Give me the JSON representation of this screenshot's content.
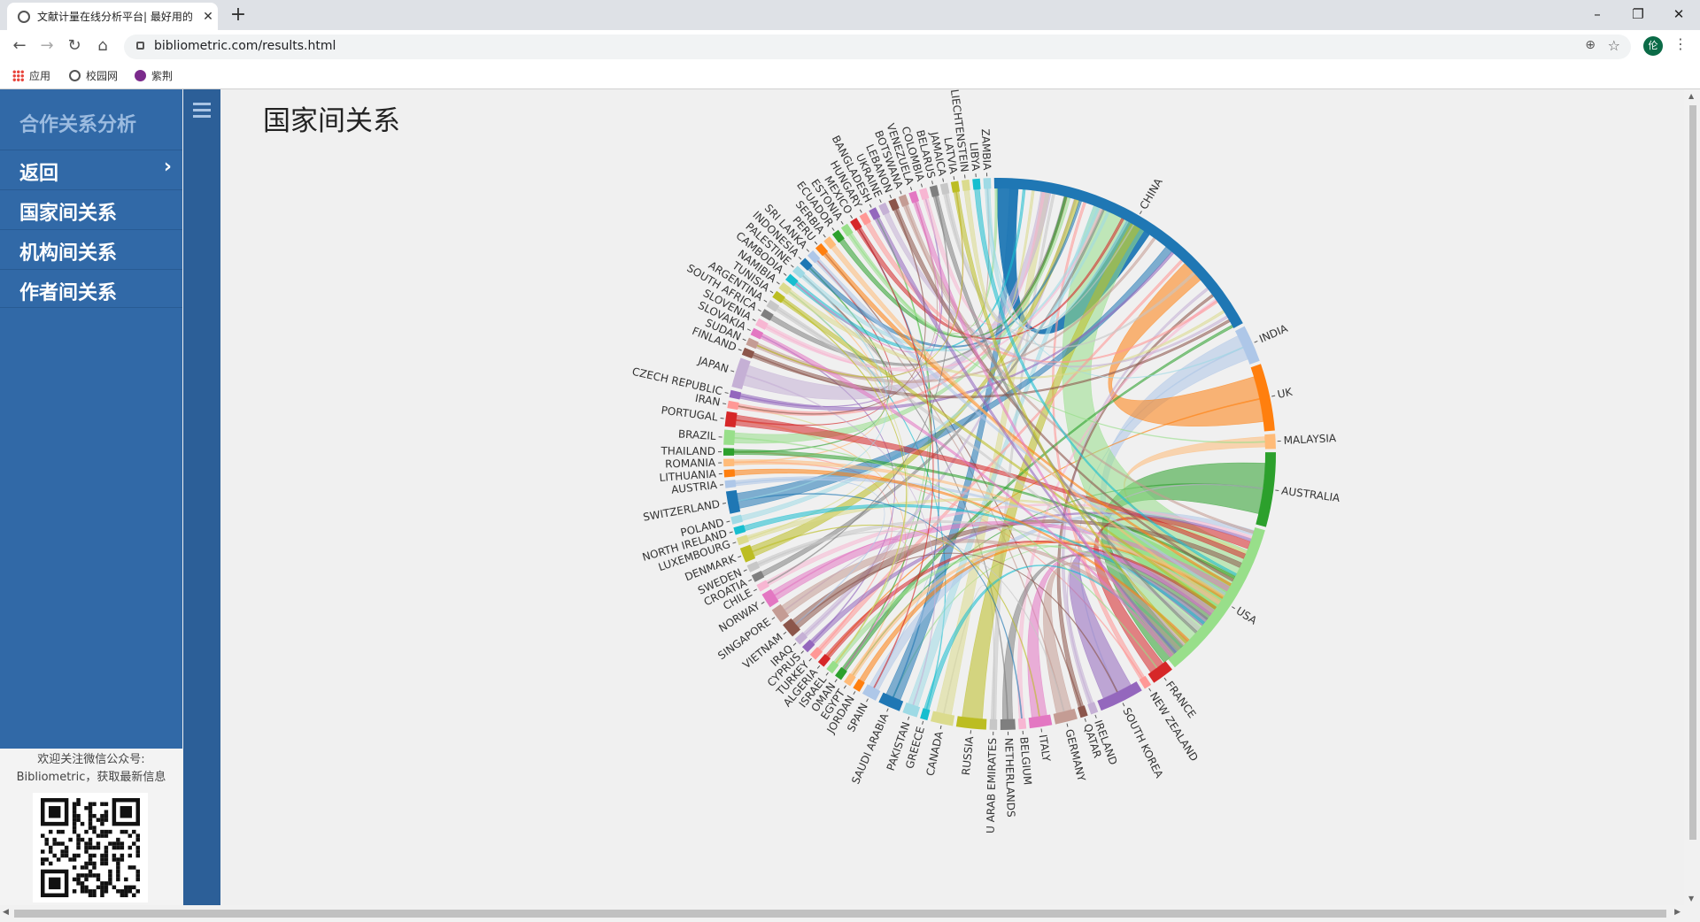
{
  "browser": {
    "tab_title": "文献计量在线分析平台| 最好用的",
    "url": "bibliometric.com/results.html",
    "avatar": "伦",
    "bookmarks": [
      "应用",
      "校园网",
      "紫荆"
    ]
  },
  "sidebar": {
    "title": "合作关系分析",
    "items": [
      {
        "label": "返回"
      },
      {
        "label": "国家间关系"
      },
      {
        "label": "机构间关系"
      },
      {
        "label": "作者间关系"
      }
    ],
    "footer_line1": "欢迎关注微信公众号:",
    "footer_line2": "Bibliometric，获取最新信息"
  },
  "main": {
    "title": "国家间关系"
  },
  "chart_data": {
    "type": "chord",
    "countries": [
      {
        "name": "CHINA",
        "color": "#1f77b4",
        "weight": 40
      },
      {
        "name": "INDIA",
        "color": "#aec7e8",
        "weight": 5
      },
      {
        "name": "UK",
        "color": "#ff7f0e",
        "weight": 9
      },
      {
        "name": "MALAYSIA",
        "color": "#ffbb78",
        "weight": 2
      },
      {
        "name": "AUSTRALIA",
        "color": "#2ca02c",
        "weight": 10
      },
      {
        "name": "USA",
        "color": "#98df8a",
        "weight": 22
      },
      {
        "name": "FRANCE",
        "color": "#d62728",
        "weight": 3
      },
      {
        "name": "NEW ZEALAND",
        "color": "#ff9896",
        "weight": 1
      },
      {
        "name": "SOUTH KOREA",
        "color": "#9467bd",
        "weight": 6
      },
      {
        "name": "IRELAND",
        "color": "#c5b0d5",
        "weight": 1
      },
      {
        "name": "QATAR",
        "color": "#8c564b",
        "weight": 1
      },
      {
        "name": "GERMANY",
        "color": "#c49c94",
        "weight": 3
      },
      {
        "name": "ITALY",
        "color": "#e377c2",
        "weight": 3
      },
      {
        "name": "BELGIUM",
        "color": "#f7b6d2",
        "weight": 1
      },
      {
        "name": "NETHERLANDS",
        "color": "#7f7f7f",
        "weight": 2
      },
      {
        "name": "U ARAB EMIRATES",
        "color": "#c7c7c7",
        "weight": 1
      },
      {
        "name": "RUSSIA",
        "color": "#bcbd22",
        "weight": 4
      },
      {
        "name": "CANADA",
        "color": "#dbdb8d",
        "weight": 3
      },
      {
        "name": "GREECE",
        "color": "#17becf",
        "weight": 1
      },
      {
        "name": "PAKISTAN",
        "color": "#9edae5",
        "weight": 2
      },
      {
        "name": "SAUDI ARABIA",
        "color": "#1f77b4",
        "weight": 3
      },
      {
        "name": "SPAIN",
        "color": "#aec7e8",
        "weight": 2
      },
      {
        "name": "JORDAN",
        "color": "#ff7f0e",
        "weight": 1
      },
      {
        "name": "EGYPT",
        "color": "#ffbb78",
        "weight": 1
      },
      {
        "name": "OMAN",
        "color": "#2ca02c",
        "weight": 1
      },
      {
        "name": "ISRAEL",
        "color": "#98df8a",
        "weight": 1
      },
      {
        "name": "ALGERIA",
        "color": "#d62728",
        "weight": 1
      },
      {
        "name": "TURKEY",
        "color": "#ff9896",
        "weight": 1
      },
      {
        "name": "CYPRUS",
        "color": "#9467bd",
        "weight": 1
      },
      {
        "name": "IRAQ",
        "color": "#c5b0d5",
        "weight": 1
      },
      {
        "name": "VIETNAM",
        "color": "#8c564b",
        "weight": 2
      },
      {
        "name": "SINGAPORE",
        "color": "#c49c94",
        "weight": 2
      },
      {
        "name": "NORWAY",
        "color": "#e377c2",
        "weight": 2
      },
      {
        "name": "CHILE",
        "color": "#f7b6d2",
        "weight": 1
      },
      {
        "name": "CROATIA",
        "color": "#7f7f7f",
        "weight": 1
      },
      {
        "name": "SWEDEN",
        "color": "#c7c7c7",
        "weight": 1
      },
      {
        "name": "DENMARK",
        "color": "#bcbd22",
        "weight": 2
      },
      {
        "name": "LUXEMBOURG",
        "color": "#dbdb8d",
        "weight": 1
      },
      {
        "name": "NORTH IRELAND",
        "color": "#17becf",
        "weight": 1
      },
      {
        "name": "POLAND",
        "color": "#9edae5",
        "weight": 1
      },
      {
        "name": "SWITZERLAND",
        "color": "#1f77b4",
        "weight": 3
      },
      {
        "name": "AUSTRIA",
        "color": "#aec7e8",
        "weight": 1
      },
      {
        "name": "LITHUANIA",
        "color": "#ff7f0e",
        "weight": 1
      },
      {
        "name": "ROMANIA",
        "color": "#ffbb78",
        "weight": 1
      },
      {
        "name": "THAILAND",
        "color": "#2ca02c",
        "weight": 1
      },
      {
        "name": "BRAZIL",
        "color": "#98df8a",
        "weight": 2
      },
      {
        "name": "PORTUGAL",
        "color": "#d62728",
        "weight": 2
      },
      {
        "name": "IRAN",
        "color": "#ff9896",
        "weight": 1
      },
      {
        "name": "CZECH REPUBLIC",
        "color": "#9467bd",
        "weight": 1
      },
      {
        "name": "JAPAN",
        "color": "#c5b0d5",
        "weight": 4
      },
      {
        "name": "FINLAND",
        "color": "#8c564b",
        "weight": 1
      },
      {
        "name": "SUDAN",
        "color": "#c49c94",
        "weight": 1
      },
      {
        "name": "SLOVAKIA",
        "color": "#e377c2",
        "weight": 1
      },
      {
        "name": "SLOVENIA",
        "color": "#f7b6d2",
        "weight": 1
      },
      {
        "name": "SOUTH AFRICA",
        "color": "#7f7f7f",
        "weight": 1
      },
      {
        "name": "ARGENTINA",
        "color": "#c7c7c7",
        "weight": 1
      },
      {
        "name": "TUNISIA",
        "color": "#bcbd22",
        "weight": 1
      },
      {
        "name": "NAMIBIA",
        "color": "#dbdb8d",
        "weight": 1
      },
      {
        "name": "CAMBODIA",
        "color": "#17becf",
        "weight": 1
      },
      {
        "name": "PALESTINE",
        "color": "#9edae5",
        "weight": 1
      },
      {
        "name": "INDONESIA",
        "color": "#1f77b4",
        "weight": 1
      },
      {
        "name": "SRI LANKA",
        "color": "#aec7e8",
        "weight": 1
      },
      {
        "name": "PERU",
        "color": "#ff7f0e",
        "weight": 1
      },
      {
        "name": "SERBIA",
        "color": "#ffbb78",
        "weight": 1
      },
      {
        "name": "ECUADOR",
        "color": "#2ca02c",
        "weight": 1
      },
      {
        "name": "ESTONIA",
        "color": "#98df8a",
        "weight": 1
      },
      {
        "name": "MEXICO",
        "color": "#d62728",
        "weight": 1
      },
      {
        "name": "HUNGARY",
        "color": "#ff9896",
        "weight": 1
      },
      {
        "name": "BANGLADESH",
        "color": "#9467bd",
        "weight": 1
      },
      {
        "name": "UKRAINE",
        "color": "#c5b0d5",
        "weight": 1
      },
      {
        "name": "LEBANON",
        "color": "#8c564b",
        "weight": 1
      },
      {
        "name": "BOTSWANA",
        "color": "#c49c94",
        "weight": 1
      },
      {
        "name": "VENEZUELA",
        "color": "#e377c2",
        "weight": 1
      },
      {
        "name": "COLOMBIA",
        "color": "#f7b6d2",
        "weight": 1
      },
      {
        "name": "BELARUS",
        "color": "#7f7f7f",
        "weight": 1
      },
      {
        "name": "JAMAICA",
        "color": "#c7c7c7",
        "weight": 1
      },
      {
        "name": "LATVIA",
        "color": "#bcbd22",
        "weight": 1
      },
      {
        "name": "LIECHTENSTEIN",
        "color": "#dbdb8d",
        "weight": 1
      },
      {
        "name": "LIBYA",
        "color": "#17becf",
        "weight": 1
      },
      {
        "name": "ZAMBIA",
        "color": "#9edae5",
        "weight": 1
      }
    ]
  }
}
